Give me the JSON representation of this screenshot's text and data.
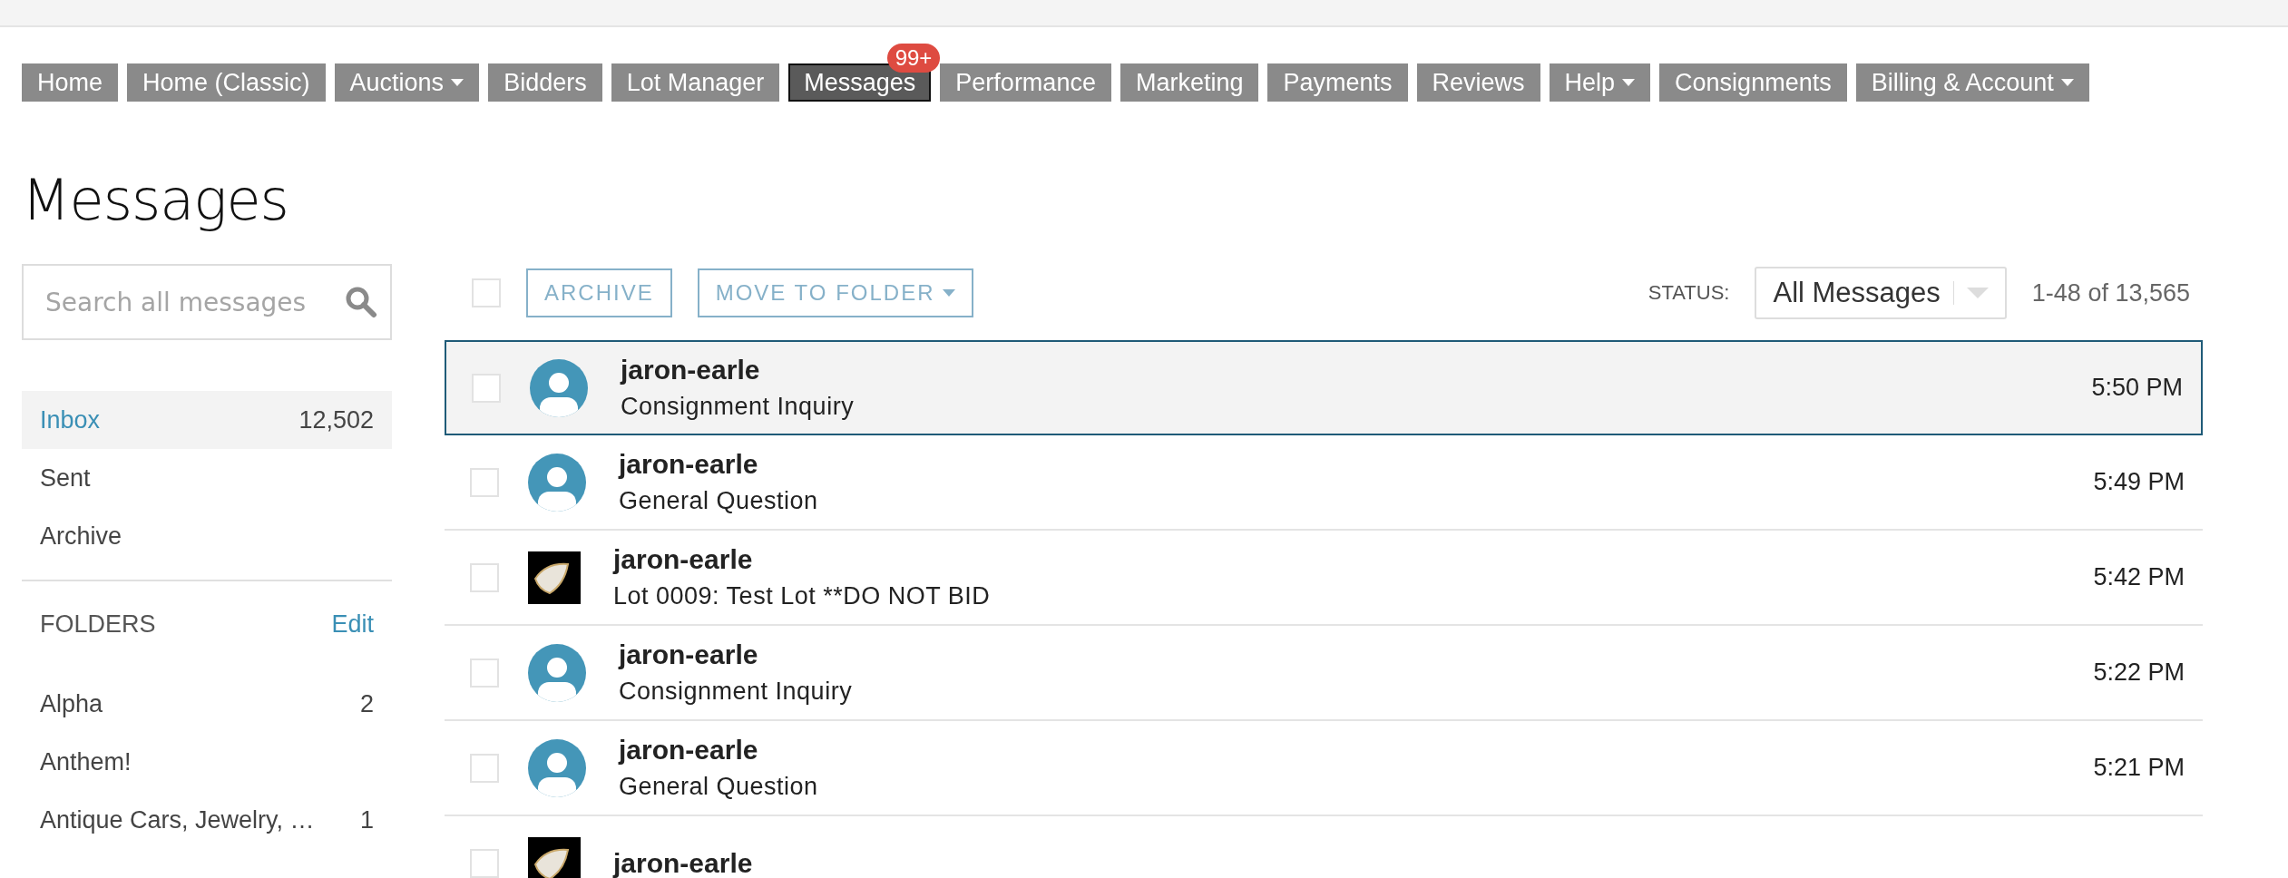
{
  "nav": [
    {
      "label": "Home",
      "dropdown": false,
      "selected": false
    },
    {
      "label": "Home (Classic)",
      "dropdown": false,
      "selected": false
    },
    {
      "label": "Auctions",
      "dropdown": true,
      "selected": false
    },
    {
      "label": "Bidders",
      "dropdown": false,
      "selected": false
    },
    {
      "label": "Lot Manager",
      "dropdown": false,
      "selected": false
    },
    {
      "label": "Messages",
      "dropdown": false,
      "selected": true,
      "badge": "99+"
    },
    {
      "label": "Performance",
      "dropdown": false,
      "selected": false
    },
    {
      "label": "Marketing",
      "dropdown": false,
      "selected": false
    },
    {
      "label": "Payments",
      "dropdown": false,
      "selected": false
    },
    {
      "label": "Reviews",
      "dropdown": false,
      "selected": false
    },
    {
      "label": "Help",
      "dropdown": true,
      "selected": false
    },
    {
      "label": "Consignments",
      "dropdown": false,
      "selected": false
    },
    {
      "label": "Billing & Account",
      "dropdown": true,
      "selected": false
    }
  ],
  "page_title": "Messages",
  "sidebar": {
    "search": {
      "placeholder": "Search all messages"
    },
    "mailboxes": [
      {
        "label": "Inbox",
        "count": "12,502",
        "selected": true
      },
      {
        "label": "Sent",
        "selected": false
      },
      {
        "label": "Archive",
        "selected": false
      }
    ],
    "folders_heading": "FOLDERS",
    "folders_edit": "Edit",
    "folders": [
      {
        "label": "Alpha",
        "count": "2"
      },
      {
        "label": "Anthem!"
      },
      {
        "label": "Antique Cars, Jewelry, …",
        "count": "1"
      }
    ]
  },
  "toolbar": {
    "select_all": {
      "checked": false
    },
    "archive": "ARCHIVE",
    "move_to_folder": "MOVE TO FOLDER",
    "status_label": "STATUS:",
    "status_value": "All Messages",
    "range": "1-48 of 13,565"
  },
  "messages": [
    {
      "sender": "jaron-earle",
      "subject": "Consignment Inquiry",
      "time": "5:50 PM",
      "kind": "person",
      "selected": true,
      "checked": false
    },
    {
      "sender": "jaron-earle",
      "subject": "General Question",
      "time": "5:49 PM",
      "kind": "person",
      "selected": false,
      "checked": false
    },
    {
      "sender": "jaron-earle",
      "subject": "Lot 0009: Test Lot **DO NOT BID",
      "time": "5:42 PM",
      "kind": "photo",
      "selected": false,
      "checked": false
    },
    {
      "sender": "jaron-earle",
      "subject": "Consignment Inquiry",
      "time": "5:22 PM",
      "kind": "person",
      "selected": false,
      "checked": false
    },
    {
      "sender": "jaron-earle",
      "subject": "General Question",
      "time": "5:21 PM",
      "kind": "person",
      "selected": false,
      "checked": false
    },
    {
      "sender": "jaron-earle",
      "kind": "photo",
      "selected": false,
      "checked": false
    }
  ]
}
